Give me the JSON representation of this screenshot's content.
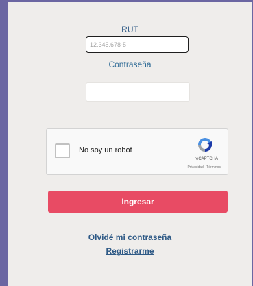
{
  "form": {
    "rut_label": "RUT",
    "rut_placeholder": "12.345.678-5",
    "rut_value": "",
    "password_label": "Contraseña",
    "password_value": ""
  },
  "captcha": {
    "checkbox_label": "No soy un robot",
    "brand": "reCAPTCHA",
    "links": "Privacidad - Términos",
    "icon": "recaptcha-logo-icon"
  },
  "actions": {
    "submit_label": "Ingresar",
    "forgot_password_label": "Olvidé mi contraseña",
    "register_label": "Registrarme"
  },
  "colors": {
    "background": "#6b66a2",
    "panel": "#efedeb",
    "accent_button": "#e84b64",
    "link": "#2f5a86"
  }
}
